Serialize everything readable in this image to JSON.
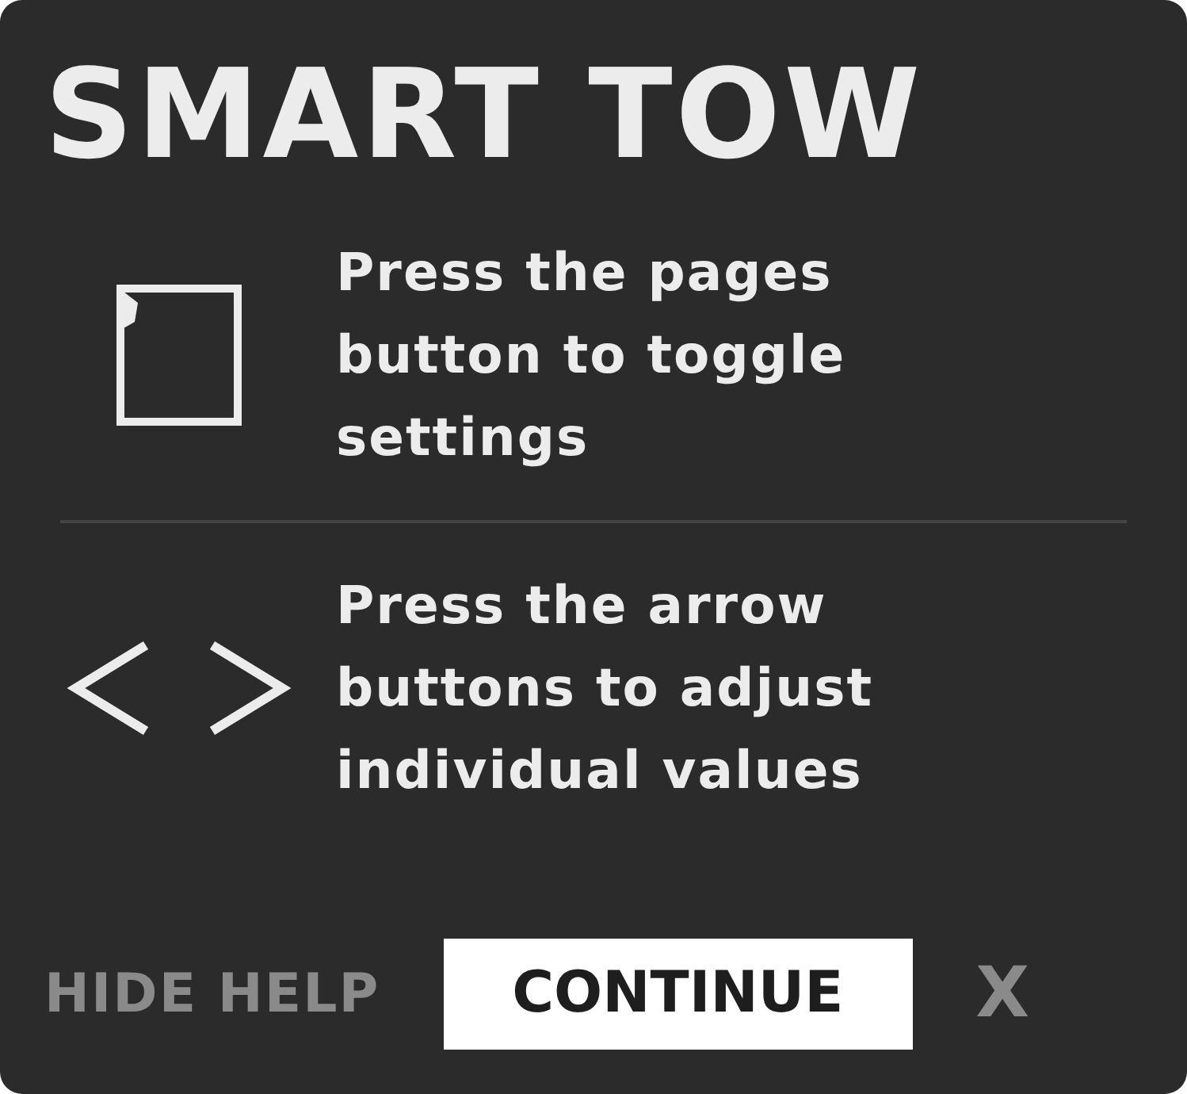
{
  "title": "SMART TOW",
  "help_items": [
    {
      "kind": "pages",
      "text": "Press the pages button to toggle settings"
    },
    {
      "kind": "arrows",
      "text": "Press the arrow buttons to adjust individual values"
    }
  ],
  "footer": {
    "hide_help": "HIDE HELP",
    "continue": "CONTINUE",
    "close": "X"
  }
}
